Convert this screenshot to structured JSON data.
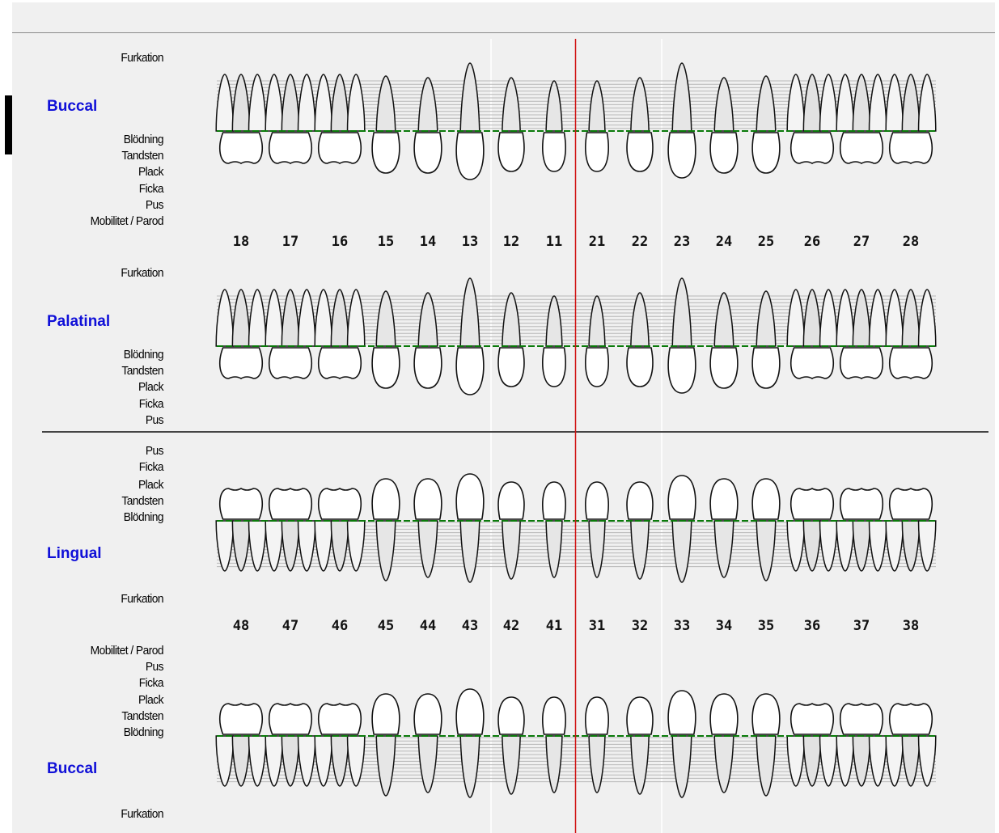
{
  "colors": {
    "section_label": "#1010d8",
    "gum_line": "#0a7a0a",
    "midline": "#d01010",
    "grid": "#b8b8b8"
  },
  "upper_buccal": {
    "section": "Buccal",
    "labels_top": [
      "Furkation"
    ],
    "labels_bottom": [
      "Blödning",
      "Tandsten",
      "Plack",
      "Ficka",
      "Pus",
      "Mobilitet / Parod"
    ]
  },
  "upper_numbers": [
    "18",
    "17",
    "16",
    "15",
    "14",
    "13",
    "12",
    "11",
    "21",
    "22",
    "23",
    "24",
    "25",
    "26",
    "27",
    "28"
  ],
  "upper_palatinal": {
    "section": "Palatinal",
    "labels_top": [
      "Furkation"
    ],
    "labels_bottom": [
      "Blödning",
      "Tandsten",
      "Plack",
      "Ficka",
      "Pus"
    ]
  },
  "lower_lingual": {
    "section": "Lingual",
    "labels_top": [
      "Pus",
      "Ficka",
      "Plack",
      "Tandsten",
      "Blödning"
    ],
    "labels_bottom": [
      "Furkation"
    ]
  },
  "lower_numbers": [
    "48",
    "47",
    "46",
    "45",
    "44",
    "43",
    "42",
    "41",
    "31",
    "32",
    "33",
    "34",
    "35",
    "36",
    "37",
    "38"
  ],
  "lower_buccal": {
    "section": "Buccal",
    "labels_top": [
      "Mobilitet / Parod",
      "Pus",
      "Ficka",
      "Plack",
      "Tandsten",
      "Blödning"
    ],
    "labels_bottom": [
      "Furkation"
    ]
  }
}
